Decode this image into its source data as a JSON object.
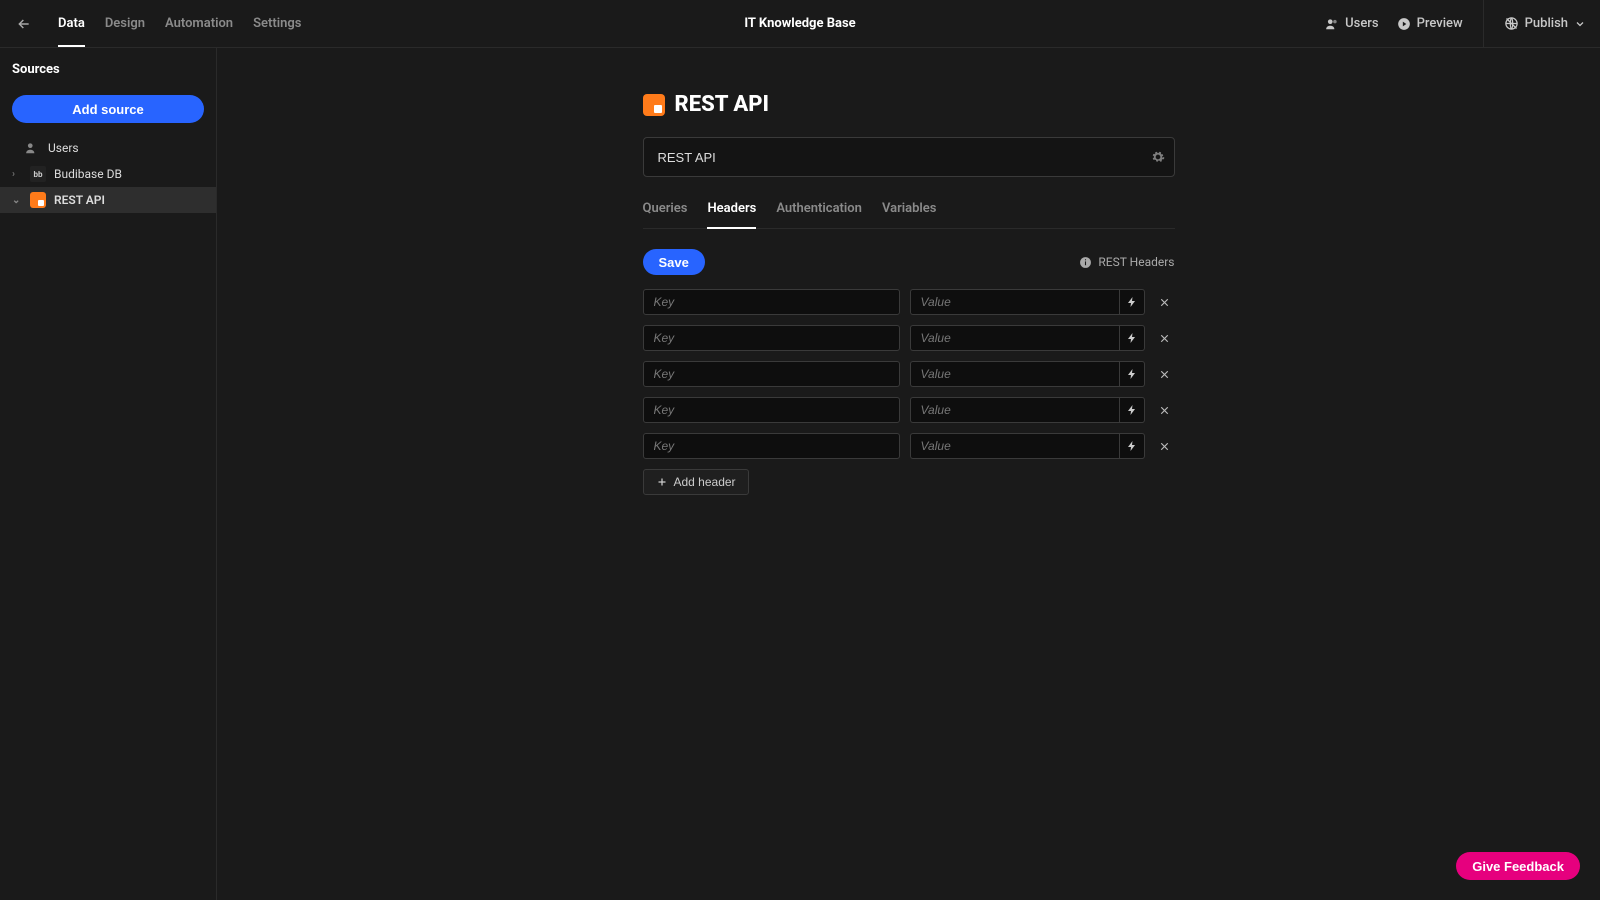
{
  "topbar": {
    "tabs": [
      "Data",
      "Design",
      "Automation",
      "Settings"
    ],
    "active_tab_index": 0,
    "app_title": "IT Knowledge Base",
    "users_label": "Users",
    "preview_label": "Preview",
    "publish_label": "Publish"
  },
  "sidebar": {
    "heading": "Sources",
    "add_source_label": "Add source",
    "items": [
      {
        "label": "Users",
        "icon": "users"
      },
      {
        "label": "Budibase DB",
        "icon": "bb",
        "expandable": true,
        "expanded": false
      },
      {
        "label": "REST API",
        "icon": "rest",
        "expandable": true,
        "expanded": true,
        "selected": true
      }
    ]
  },
  "page": {
    "title": "REST API",
    "name_input_value": "REST API",
    "subtabs": [
      "Queries",
      "Headers",
      "Authentication",
      "Variables"
    ],
    "active_subtab_index": 1,
    "save_label": "Save",
    "help_link_label": "REST Headers",
    "header_rows": [
      {
        "key": "",
        "key_placeholder": "Key",
        "value": "",
        "value_placeholder": "Value"
      },
      {
        "key": "",
        "key_placeholder": "Key",
        "value": "",
        "value_placeholder": "Value"
      },
      {
        "key": "",
        "key_placeholder": "Key",
        "value": "",
        "value_placeholder": "Value"
      },
      {
        "key": "",
        "key_placeholder": "Key",
        "value": "",
        "value_placeholder": "Value"
      },
      {
        "key": "",
        "key_placeholder": "Key",
        "value": "",
        "value_placeholder": "Value"
      }
    ],
    "add_header_label": "Add header"
  },
  "feedback_label": "Give Feedback"
}
